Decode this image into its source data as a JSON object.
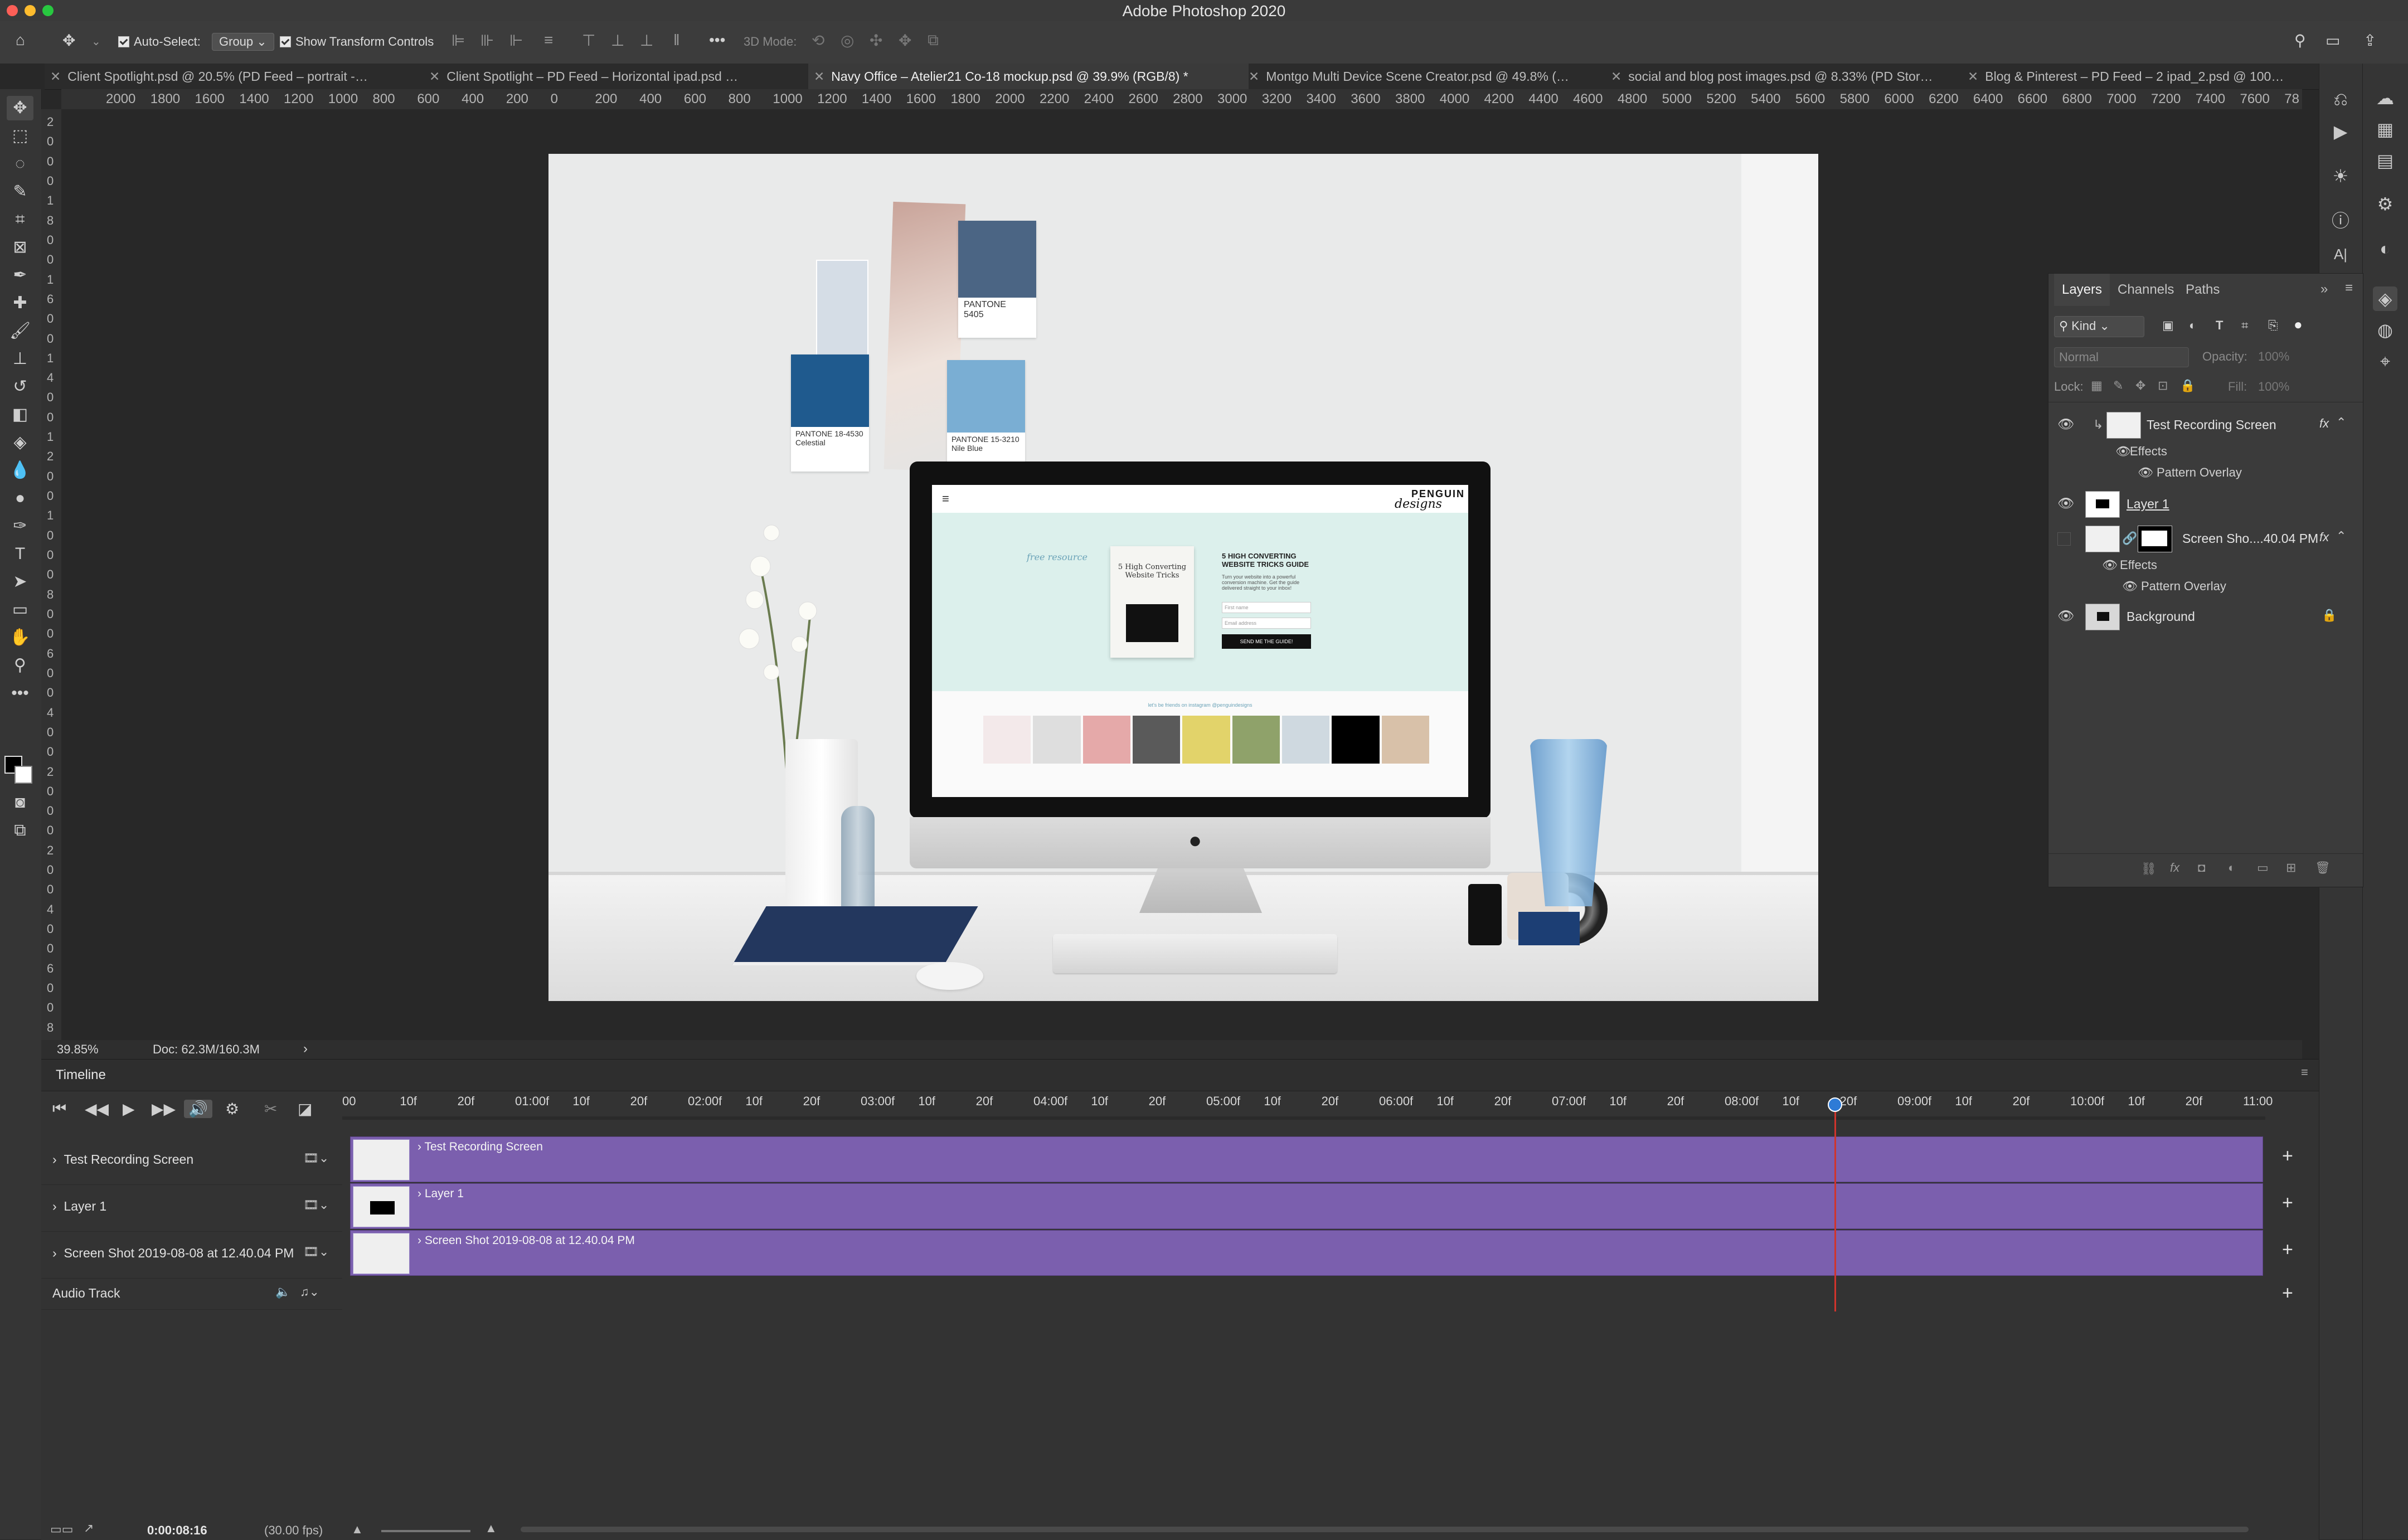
{
  "window": {
    "title": "Adobe Photoshop 2020"
  },
  "options_bar": {
    "auto_select_label": "Auto-Select:",
    "auto_select_value": "Group",
    "show_transform_label": "Show Transform Controls",
    "mode_3d_label": "3D Mode:",
    "more_label": "•••"
  },
  "tabs": [
    {
      "label": "Client Spotlight.psd @ 20.5% (PD Feed – portrait -…",
      "active": false
    },
    {
      "label": "Client Spotlight – PD Feed – Horizontal ipad.psd …",
      "active": false
    },
    {
      "label": "Navy Office – Atelier21 Co-18 mockup.psd @ 39.9% (RGB/8) *",
      "active": true
    },
    {
      "label": "Montgo Multi Device Scene Creator.psd @ 49.8% (…",
      "active": false
    },
    {
      "label": "social and blog post images.psd @ 8.33% (PD Stor…",
      "active": false
    },
    {
      "label": "Blog & Pinterest – PD Feed – 2 ipad_2.psd @ 100…",
      "active": false
    }
  ],
  "ruler_h": [
    "2000",
    "1800",
    "1600",
    "1400",
    "1200",
    "1000",
    "800",
    "600",
    "400",
    "200",
    "0",
    "200",
    "400",
    "600",
    "800",
    "1000",
    "1200",
    "1400",
    "1600",
    "1800",
    "2000",
    "2200",
    "2400",
    "2600",
    "2800",
    "3000",
    "3200",
    "3400",
    "3600",
    "3800",
    "4000",
    "4200",
    "4400",
    "4600",
    "4800",
    "5000",
    "5200",
    "5400",
    "5600",
    "5800",
    "6000",
    "6200",
    "6400",
    "6600",
    "6800",
    "7000",
    "7200",
    "7400",
    "7600",
    "78"
  ],
  "ruler_v": [
    "2",
    "0",
    "0",
    "0",
    "1",
    "8",
    "0",
    "0",
    "1",
    "6",
    "0",
    "0",
    "1",
    "4",
    "0",
    "0",
    "1",
    "2",
    "0",
    "0",
    "1",
    "0",
    "0",
    "0",
    "8",
    "0",
    "0",
    "6",
    "0",
    "0",
    "4",
    "0",
    "0",
    "2",
    "0",
    "0",
    "0",
    "2",
    "0",
    "0",
    "4",
    "0",
    "0",
    "6",
    "0",
    "0",
    "8"
  ],
  "status": {
    "zoom": "39.85%",
    "doc": "Doc: 62.3M/160.3M"
  },
  "mockup": {
    "pantones": [
      {
        "code": "PANTONE\n5405",
        "color": "#4b6584"
      },
      {
        "code": "PANTONE 18-4530\nCelestial",
        "color": "#1f5a8e"
      },
      {
        "code": "PANTONE 15-3210\nNile Blue",
        "color": "#7aaed3"
      }
    ],
    "screen": {
      "brand": "PENGUIN",
      "brand_sub": "designs",
      "free_resource": "free resource",
      "ebook_title": "5 High Converting Website Tricks",
      "headline": "5 HIGH CONVERTING WEBSITE TRICKS GUIDE",
      "body": "Turn your website into a powerful conversion machine. Get the guide delivered straight to your inbox!",
      "first_name_ph": "First name",
      "email_ph": "Email address",
      "cta": "SEND ME THE GUIDE!",
      "instagram_caption": "let's be friends on instagram @penguindesigns"
    }
  },
  "layers_panel": {
    "tabs": [
      "Layers",
      "Channels",
      "Paths"
    ],
    "kind_label": "Kind",
    "blend_mode": "Normal",
    "opacity_label": "Opacity:",
    "opacity_value": "100%",
    "lock_label": "Lock:",
    "fill_label": "Fill:",
    "fill_value": "100%",
    "layers": [
      {
        "name": "Test Recording Screen",
        "fx": "fx",
        "effects_label": "Effects",
        "effect": "Pattern Overlay",
        "visible": true
      },
      {
        "name": "Layer 1",
        "visible": true
      },
      {
        "name": "Screen Sho....40.04 PM",
        "fx": "fx",
        "effects_label": "Effects",
        "effect": "Pattern Overlay",
        "visible": false
      },
      {
        "name": "Background",
        "visible": true
      }
    ]
  },
  "timeline": {
    "title": "Timeline",
    "ruler": [
      "00",
      "10f",
      "20f",
      "01:00f",
      "10f",
      "20f",
      "02:00f",
      "10f",
      "20f",
      "03:00f",
      "10f",
      "20f",
      "04:00f",
      "10f",
      "20f",
      "05:00f",
      "10f",
      "20f",
      "06:00f",
      "10f",
      "20f",
      "07:00f",
      "10f",
      "20f",
      "08:00f",
      "10f",
      "20f",
      "09:00f",
      "10f",
      "20f",
      "10:00f",
      "10f",
      "20f",
      "11:00"
    ],
    "tracks": [
      {
        "label": "Test Recording Screen",
        "clip": "Test Recording Screen"
      },
      {
        "label": "Layer 1",
        "clip": "Layer 1"
      },
      {
        "label": "Screen Shot 2019-08-08 at 12.40.04 PM",
        "clip": "Screen Shot 2019-08-08 at 12.40.04 PM"
      }
    ],
    "audio_label": "Audio Track",
    "current_time": "0:00:08:16",
    "fps": "(30.00 fps)",
    "playhead_fraction": 0.776
  },
  "colors": {
    "clip": "#7b5fae",
    "playhead": "#d0342c",
    "accent": "#2e7bd6"
  }
}
